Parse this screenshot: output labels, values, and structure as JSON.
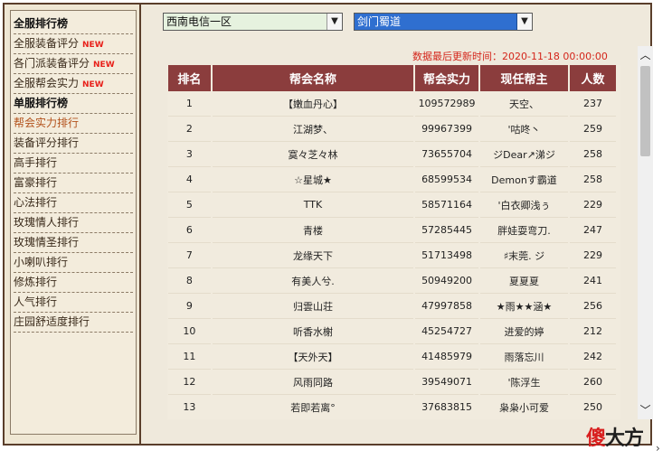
{
  "sidebar": {
    "items": [
      {
        "label": "全服排行榜",
        "type": "head"
      },
      {
        "label": "全服装备评分",
        "badge": "NEW"
      },
      {
        "label": "各门派装备评分",
        "badge": "NEW"
      },
      {
        "label": "全服帮会实力",
        "badge": "NEW"
      },
      {
        "label": "单服排行榜",
        "type": "head"
      },
      {
        "label": "帮会实力排行",
        "active": true
      },
      {
        "label": "装备评分排行"
      },
      {
        "label": "高手排行"
      },
      {
        "label": "富豪排行"
      },
      {
        "label": "心法排行"
      },
      {
        "label": "玫瑰情人排行"
      },
      {
        "label": "玫瑰情圣排行"
      },
      {
        "label": "小喇叭排行"
      },
      {
        "label": "修炼排行"
      },
      {
        "label": "人气排行"
      },
      {
        "label": "庄园舒适度排行"
      }
    ]
  },
  "filters": {
    "server": "西南电信一区",
    "guild": "剑门蜀道"
  },
  "update_time": "数据最后更新时间：2020-11-18 00:00:00",
  "table": {
    "headers": [
      "排名",
      "帮会名称",
      "帮会实力",
      "现任帮主",
      "人数"
    ],
    "rows": [
      [
        "1",
        "【嫩血丹心】",
        "109572989",
        "天空、",
        "237"
      ],
      [
        "2",
        "江湖梦、",
        "99967399",
        "'咕咚丶",
        "259"
      ],
      [
        "3",
        "寞々芝々林",
        "73655704",
        "ジDear↗涕ジ",
        "258"
      ],
      [
        "4",
        "☆星城★",
        "68599534",
        "Demonす霸道",
        "258"
      ],
      [
        "5",
        "TTK",
        "58571164",
        "'白衣卿浅ぅ",
        "229"
      ],
      [
        "6",
        "青楼",
        "57285445",
        "胖娃耍弯刀.",
        "247"
      ],
      [
        "7",
        "龙缘天下",
        "51713498",
        "♯末莞. ジ",
        "229"
      ],
      [
        "8",
        "有美人兮.",
        "50949200",
        "夏夏夏",
        "241"
      ],
      [
        "9",
        "归雲山荘",
        "47997858",
        "★雨★★涵★",
        "256"
      ],
      [
        "10",
        "听香水榭",
        "45254727",
        "进爱的婷",
        "212"
      ],
      [
        "11",
        "【天外天】",
        "41485979",
        "雨落忘川",
        "242"
      ],
      [
        "12",
        "风雨同路",
        "39549071",
        "'陈浮生",
        "260"
      ],
      [
        "13",
        "若即若离°",
        "37683815",
        "枭枭小可爱",
        "250"
      ]
    ]
  },
  "watermark": {
    "c1": "傻",
    "c2": "大方"
  },
  "icons": {
    "dropdown": "▼",
    "scroll_up": "︿",
    "scroll_down": "﹀",
    "scroll_right": "›"
  }
}
